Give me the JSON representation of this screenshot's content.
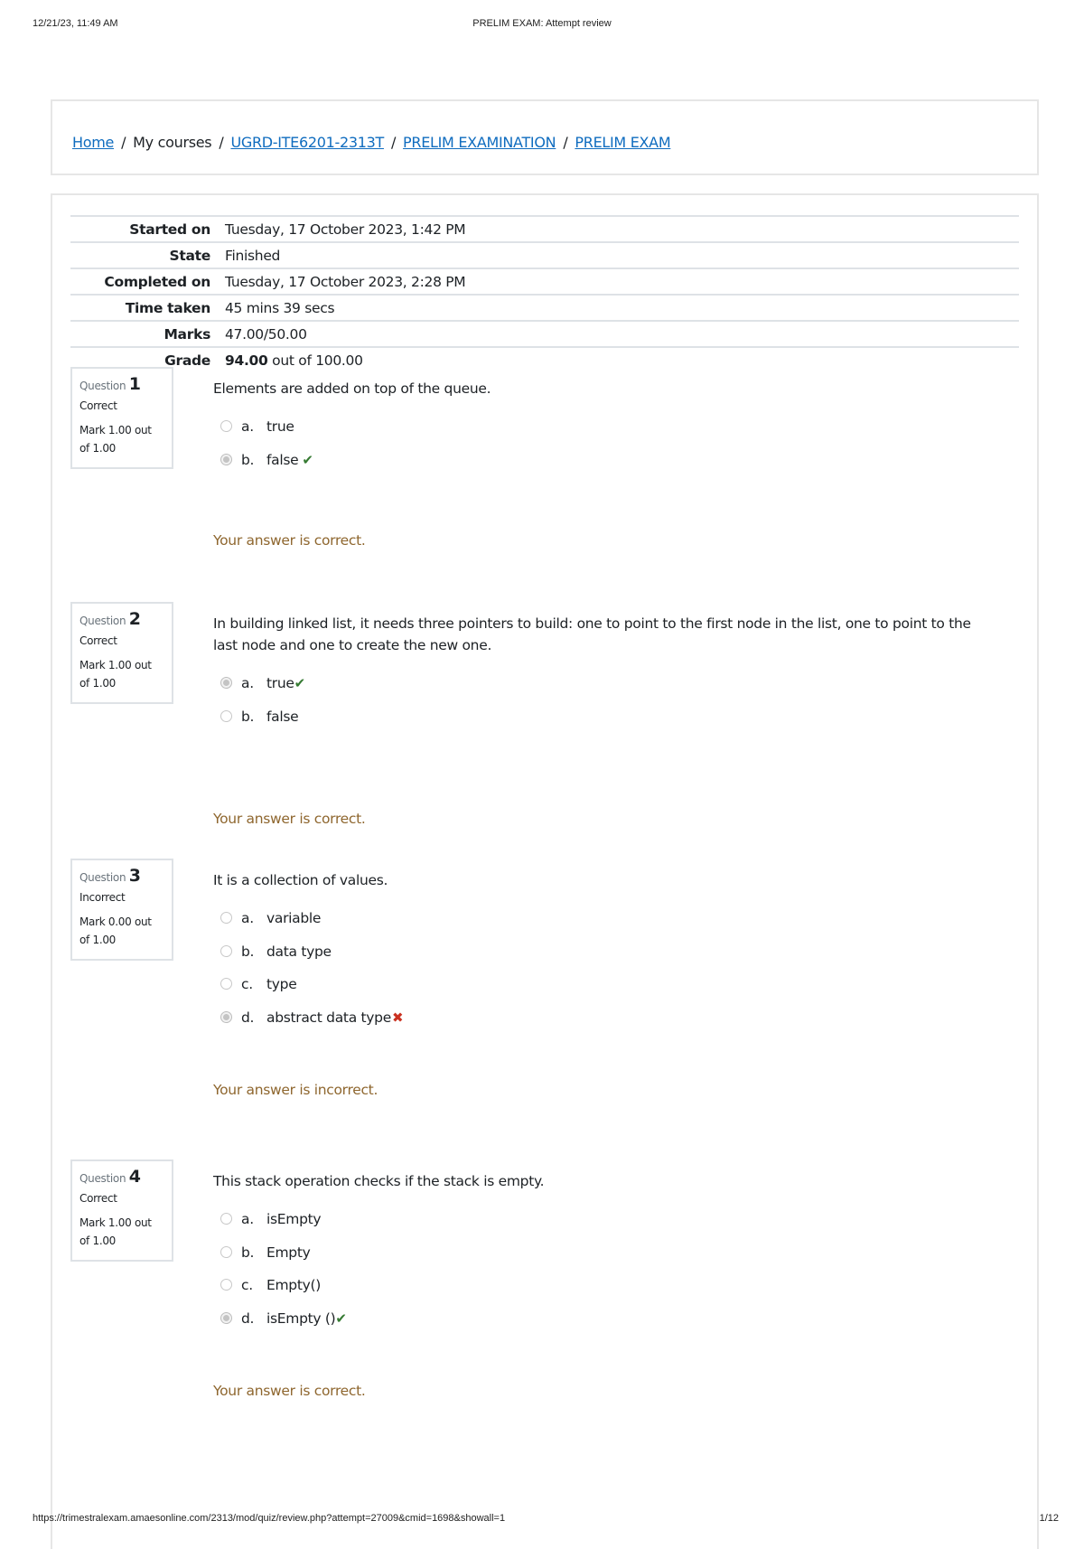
{
  "print_header": {
    "datetime": "12/21/23, 11:49 AM",
    "title": "PRELIM EXAM: Attempt review"
  },
  "print_footer": {
    "url": "https://trimestralexam.amaesonline.com/2313/mod/quiz/review.php?attempt=27009&cmid=1698&showall=1",
    "page": "1/12"
  },
  "breadcrumb": {
    "items": [
      {
        "label": "Home",
        "link": true
      },
      {
        "label": "My courses",
        "link": false
      },
      {
        "label": "UGRD-ITE6201-2313T",
        "link": true
      },
      {
        "label": "PRELIM EXAMINATION",
        "link": true
      },
      {
        "label": "PRELIM EXAM",
        "link": true
      }
    ],
    "separator": "/"
  },
  "summary": {
    "rows": [
      {
        "label": "Started on",
        "value": "Tuesday, 17 October 2023, 1:42 PM"
      },
      {
        "label": "State",
        "value": "Finished"
      },
      {
        "label": "Completed on",
        "value": "Tuesday, 17 October 2023, 2:28 PM"
      },
      {
        "label": "Time taken",
        "value": "45 mins 39 secs"
      },
      {
        "label": "Marks",
        "value": "47.00/50.00"
      },
      {
        "label": "Grade",
        "value_bold": "94.00",
        "value_rest": " out of 100.00"
      }
    ]
  },
  "colors": {
    "link": "#0f6cbf",
    "correct_icon": "#357a32",
    "incorrect_icon": "#ca3120",
    "feedback": "#8e662e"
  },
  "questions": [
    {
      "label": "Question",
      "number": "1",
      "state": "Correct",
      "mark": "Mark 1.00 out of 1.00",
      "text": "Elements are added on top of the queue.",
      "options": [
        {
          "letter": "a.",
          "text": "true",
          "selected": false,
          "result": ""
        },
        {
          "letter": "b.",
          "text": "false",
          "selected": true,
          "result": "correct"
        }
      ],
      "feedback": "Your answer is correct."
    },
    {
      "label": "Question",
      "number": "2",
      "state": "Correct",
      "mark": "Mark 1.00 out of 1.00",
      "text": "In building linked list, it needs three pointers to build: one to point to the first node in the list, one to point to the last node and one to create the new one.",
      "options": [
        {
          "letter": "a.",
          "text": "true",
          "selected": true,
          "result": "correct"
        },
        {
          "letter": "b.",
          "text": "false",
          "selected": false,
          "result": ""
        }
      ],
      "feedback": "Your answer is correct."
    },
    {
      "label": "Question",
      "number": "3",
      "state": "Incorrect",
      "mark": "Mark 0.00 out of 1.00",
      "text": "It is a collection of values.",
      "options": [
        {
          "letter": "a.",
          "text": "variable",
          "selected": false,
          "result": ""
        },
        {
          "letter": "b.",
          "text": "data type",
          "selected": false,
          "result": ""
        },
        {
          "letter": "c.",
          "text": "type",
          "selected": false,
          "result": ""
        },
        {
          "letter": "d.",
          "text": "abstract data type",
          "selected": true,
          "result": "incorrect"
        }
      ],
      "feedback": "Your answer is incorrect."
    },
    {
      "label": "Question",
      "number": "4",
      "state": "Correct",
      "mark": "Mark 1.00 out of 1.00",
      "text": "This stack operation checks if the stack is empty.",
      "options": [
        {
          "letter": "a.",
          "text": "isEmpty",
          "selected": false,
          "result": ""
        },
        {
          "letter": "b.",
          "text": "Empty",
          "selected": false,
          "result": ""
        },
        {
          "letter": "c.",
          "text": "Empty()",
          "selected": false,
          "result": ""
        },
        {
          "letter": "d.",
          "text": "isEmpty ()",
          "selected": true,
          "result": "correct"
        }
      ],
      "feedback": "Your answer is correct."
    }
  ],
  "icons": {
    "correct": "✔",
    "incorrect": "✖"
  }
}
